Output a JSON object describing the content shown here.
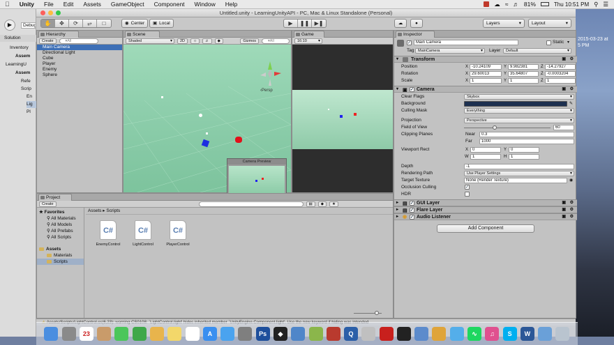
{
  "menubar": {
    "items": [
      "Unity",
      "File",
      "Edit",
      "Assets",
      "GameObject",
      "Component",
      "Window",
      "Help"
    ],
    "battery": "81%",
    "clock": "Thu 10:51 PM"
  },
  "desktop": {
    "date_text": "2015-03-23 at",
    "time_text": "5 PM"
  },
  "left_strip": {
    "debug": "Debug",
    "solution": "Solution",
    "items": [
      "Inventory",
      "Assem",
      "LearningU",
      "Assem",
      "Refe",
      "Scrip",
      "En",
      "Lig",
      "Pl"
    ]
  },
  "window": {
    "title": "Untitled.unity - LearningUnityAPI - PC, Mac & Linux Standalone (Personal)"
  },
  "toolbar": {
    "center": "Center",
    "local": "Local",
    "layers": "Layers",
    "layout": "Layout"
  },
  "hierarchy": {
    "tab": "Hierarchy",
    "create": "Create",
    "search_placeholder": "▾All",
    "items": [
      "Main Camera",
      "Directional Light",
      "Cube",
      "Player",
      "Enemy",
      "Sphere"
    ]
  },
  "scene": {
    "tab": "Scene",
    "shaded": "Shaded",
    "mode_2d": "2D",
    "gizmos": "Gizmos",
    "search_placeholder": "▾All",
    "persp": "‹Persp",
    "camera_preview": "Camera Preview"
  },
  "game": {
    "tab": "Game",
    "aspect": "16:10"
  },
  "inspector": {
    "tab": "Inspector",
    "object_name": "Main Camera",
    "static_label": "Static",
    "tag_label": "Tag",
    "tag_value": "MainCamera",
    "layer_label": "Layer",
    "layer_value": "Default",
    "transform": {
      "title": "Transform",
      "position_label": "Position",
      "position": [
        "-10.24109",
        "9.982381",
        "-14.27927"
      ],
      "rotation_label": "Rotation",
      "rotation": [
        "29.60013",
        "35.64807",
        "-0.0003204"
      ],
      "scale_label": "Scale",
      "scale": [
        "1",
        "1",
        "1"
      ]
    },
    "camera": {
      "title": "Camera",
      "clear_flags_label": "Clear Flags",
      "clear_flags": "Skybox",
      "background_label": "Background",
      "background_color": "#1d3050",
      "culling_mask_label": "Culling Mask",
      "culling_mask": "Everything",
      "projection_label": "Projection",
      "projection": "Perspective",
      "fov_label": "Field of View",
      "fov": "60",
      "fov_fraction": 0.34,
      "clipping_label": "Clipping Planes",
      "near_label": "Near",
      "near": "0.3",
      "far_label": "Far",
      "far": "1000",
      "viewport_label": "Viewport Rect",
      "vx": "0",
      "vy": "0",
      "vw": "1",
      "vh": "1",
      "depth_label": "Depth",
      "depth": "-1",
      "rendering_label": "Rendering Path",
      "rendering": "Use Player Settings",
      "target_label": "Target Texture",
      "target": "None (Render Texture)",
      "occlusion_label": "Occlusion Culling",
      "hdr_label": "HDR"
    },
    "gui_layer": "GUI Layer",
    "flare_layer": "Flare Layer",
    "audio_listener": "Audio Listener",
    "add_component": "Add Component"
  },
  "project": {
    "tab": "Project",
    "create": "Create",
    "favorites": "Favorites",
    "fav_items": [
      "All Materials",
      "All Models",
      "All Prefabs",
      "All Scripts"
    ],
    "assets": "Assets",
    "asset_children": [
      "Materials",
      "Scripts"
    ],
    "breadcrumb": "Assets ▸ Scripts",
    "files": [
      "EnemyControl",
      "LightControl",
      "PlayerControl"
    ],
    "file_glyph": "C#"
  },
  "status": {
    "text": "Assets/Scripts/LightControl.cs(6,23): warning CS0108: `LightControl.light' hides inherited member `UnityEngine.Component.light'. Use the new keyword if hiding was intended"
  },
  "dock": {
    "icons": [
      "finder",
      "launchpad",
      "calendar",
      "contacts",
      "messages",
      "facetime",
      "photos",
      "notes",
      "reminders",
      "app-store",
      "safari",
      "system-prefs",
      "photoshop",
      "unity",
      "xcode",
      "mono",
      "filezilla",
      "quicktime",
      "script",
      "acrobat",
      "terminal",
      "preview",
      "lamp",
      "twitter",
      "spotify",
      "itunes",
      "skype",
      "word",
      "downloads",
      "trash"
    ],
    "colors": [
      "#4a8ee0",
      "#8a8a8a",
      "#ffffff",
      "#c99b6a",
      "#4bc65a",
      "#3fa84a",
      "#e8b44c",
      "#f3d76a",
      "#ffffff",
      "#3a8ff0",
      "#4aa3ef",
      "#7f7f7f",
      "#1e4f9c",
      "#222222",
      "#4f86c9",
      "#8bb64b",
      "#b93a2e",
      "#2b5fa8",
      "#c0c0c0",
      "#c8201d",
      "#222222",
      "#5c8bcc",
      "#dfa43a",
      "#54aeea",
      "#1ed760",
      "#e0508f",
      "#00aff0",
      "#2b5797",
      "#6aa0d8",
      "#b9c4cf"
    ],
    "glyphs": [
      "",
      "",
      "23",
      "",
      "",
      "",
      "",
      "",
      "",
      "A",
      "",
      "",
      "Ps",
      "◆",
      "",
      "",
      "",
      "Q",
      "",
      "",
      "",
      "",
      "",
      "",
      "∿",
      "♫",
      "S",
      "W",
      "",
      ""
    ]
  }
}
